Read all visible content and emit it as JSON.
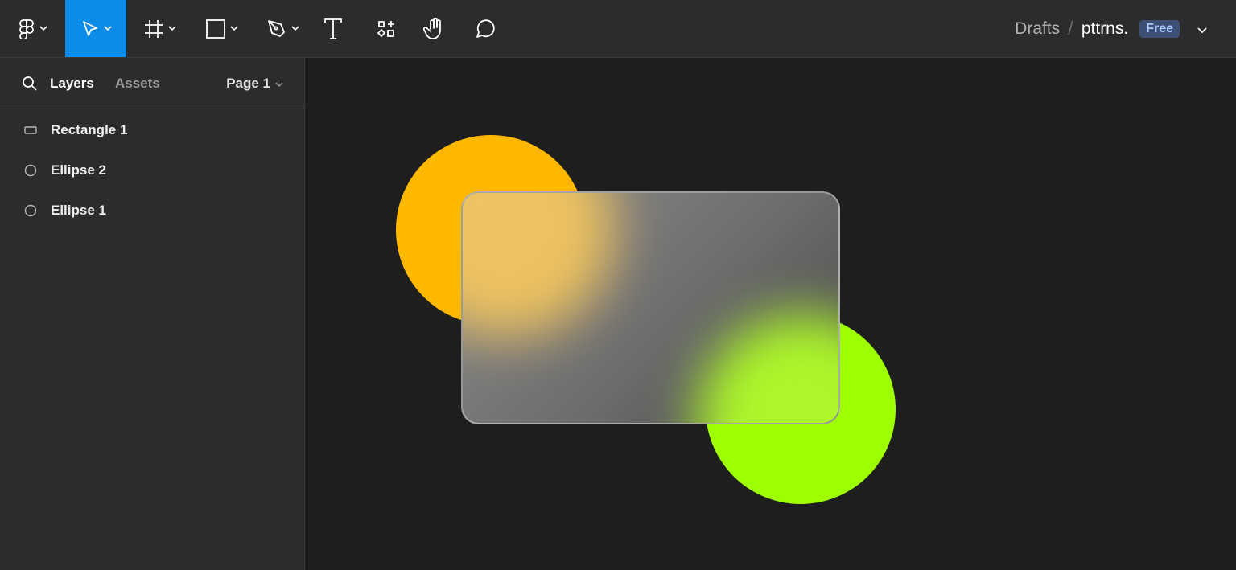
{
  "toolbar": {
    "tools": [
      {
        "id": "main-menu",
        "icon": "figma-logo-icon",
        "active": false
      },
      {
        "id": "move",
        "icon": "move-cursor-icon",
        "active": true
      },
      {
        "id": "frame",
        "icon": "frame-hash-icon",
        "active": false
      },
      {
        "id": "shape",
        "icon": "rectangle-icon",
        "active": false
      },
      {
        "id": "pen",
        "icon": "pen-icon",
        "active": false
      },
      {
        "id": "text",
        "icon": "text-icon",
        "active": false
      },
      {
        "id": "resources",
        "icon": "resources-icon",
        "active": false
      },
      {
        "id": "hand",
        "icon": "hand-icon",
        "active": false
      },
      {
        "id": "comment",
        "icon": "comment-icon",
        "active": false
      }
    ],
    "active_color": "#0c8ce9"
  },
  "breadcrumb": {
    "root": "Drafts",
    "separator": "/",
    "file_name": "pttrns.",
    "plan_badge": "Free"
  },
  "left_panel": {
    "tabs": {
      "layers": "Layers",
      "assets": "Assets"
    },
    "page_selector": "Page 1",
    "layers": [
      {
        "name": "Rectangle 1",
        "icon": "rectangle-layer-icon"
      },
      {
        "name": "Ellipse 2",
        "icon": "ellipse-layer-icon"
      },
      {
        "name": "Ellipse 1",
        "icon": "ellipse-layer-icon"
      }
    ]
  },
  "canvas": {
    "background": "#1e1e1e",
    "ellipse_1_color": "#ffb800",
    "ellipse_2_color": "#9eff00",
    "glass_blur_yellow": "rgba(255,205,90,0.85)",
    "glass_blur_green": "rgba(178,255,40,0.95)"
  }
}
